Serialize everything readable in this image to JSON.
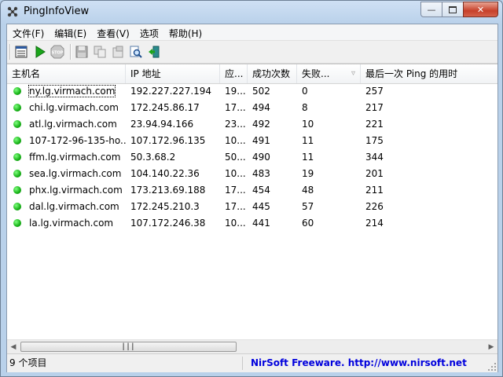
{
  "window": {
    "title": "PingInfoView"
  },
  "menu": [
    "文件(F)",
    "编辑(E)",
    "查看(V)",
    "选项",
    "帮助(H)"
  ],
  "toolbar": {
    "buttons": [
      "properties-icon",
      "play-icon",
      "stop-icon",
      "save-icon",
      "copy-icon",
      "html-report-icon",
      "find-icon",
      "exit-icon"
    ]
  },
  "columns": [
    "主机名",
    "IP 地址",
    "应...",
    "成功次数",
    "失败...",
    "最后一次 Ping 的用时"
  ],
  "rows": [
    {
      "host": "ny.lg.virmach.com",
      "ip": "192.227.227.194",
      "reply": "19...",
      "success": "502",
      "failed": "0",
      "last": "257"
    },
    {
      "host": "chi.lg.virmach.com",
      "ip": "172.245.86.17",
      "reply": "17...",
      "success": "494",
      "failed": "8",
      "last": "217"
    },
    {
      "host": "atl.lg.virmach.com",
      "ip": "23.94.94.166",
      "reply": "23...",
      "success": "492",
      "failed": "10",
      "last": "221"
    },
    {
      "host": "107-172-96-135-ho...",
      "ip": "107.172.96.135",
      "reply": "10...",
      "success": "491",
      "failed": "11",
      "last": "175"
    },
    {
      "host": "ffm.lg.virmach.com",
      "ip": "50.3.68.2",
      "reply": "50...",
      "success": "490",
      "failed": "11",
      "last": "344"
    },
    {
      "host": "sea.lg.virmach.com",
      "ip": "104.140.22.36",
      "reply": "10...",
      "success": "483",
      "failed": "19",
      "last": "201"
    },
    {
      "host": "phx.lg.virmach.com",
      "ip": "173.213.69.188",
      "reply": "17...",
      "success": "454",
      "failed": "48",
      "last": "211"
    },
    {
      "host": "dal.lg.virmach.com",
      "ip": "172.245.210.3",
      "reply": "17...",
      "success": "445",
      "failed": "57",
      "last": "226"
    },
    {
      "host": "la.lg.virmach.com",
      "ip": "107.172.246.38",
      "reply": "10...",
      "success": "441",
      "failed": "60",
      "last": "214"
    }
  ],
  "status": {
    "count": "9 个项目",
    "credit": "NirSoft Freeware.  http://www.nirsoft.net"
  },
  "colors": {
    "accent_link": "#0000dd",
    "status_dot": "#16b016"
  }
}
